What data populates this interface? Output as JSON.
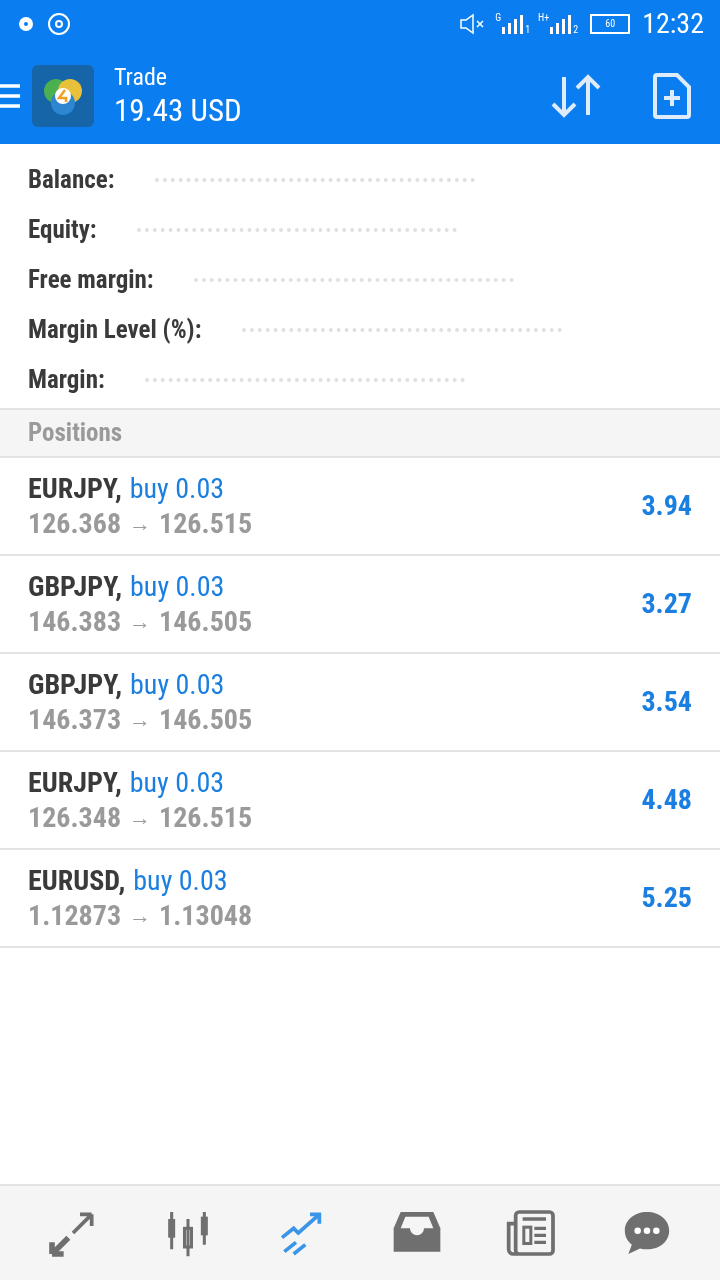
{
  "status_bar": {
    "signals": [
      {
        "network": "G",
        "sim": "1"
      },
      {
        "network": "H+",
        "sim": "2"
      }
    ],
    "battery": "60",
    "time": "12:32"
  },
  "app_bar": {
    "title": "Trade",
    "subtitle": "19.43 USD"
  },
  "account": [
    {
      "label": "Balance:"
    },
    {
      "label": "Equity:"
    },
    {
      "label": "Free margin:"
    },
    {
      "label": "Margin Level (%):"
    },
    {
      "label": "Margin:"
    }
  ],
  "positions": {
    "heading": "Positions",
    "rows": [
      {
        "symbol": "EURJPY,",
        "order": "buy 0.03",
        "open": "126.368",
        "arrow": "→",
        "current": "126.515",
        "profit": "3.94"
      },
      {
        "symbol": "GBPJPY,",
        "order": "buy 0.03",
        "open": "146.383",
        "arrow": "→",
        "current": "146.505",
        "profit": "3.27"
      },
      {
        "symbol": "GBPJPY,",
        "order": "buy 0.03",
        "open": "146.373",
        "arrow": "→",
        "current": "146.505",
        "profit": "3.54"
      },
      {
        "symbol": "EURJPY,",
        "order": "buy 0.03",
        "open": "126.348",
        "arrow": "→",
        "current": "126.515",
        "profit": "4.48"
      },
      {
        "symbol": "EURUSD,",
        "order": "buy 0.03",
        "open": "1.12873",
        "arrow": "→",
        "current": "1.13048",
        "profit": "5.25"
      }
    ]
  },
  "bottom_nav": [
    {
      "kind": "quotes",
      "selected": false
    },
    {
      "kind": "chart",
      "selected": false
    },
    {
      "kind": "trade",
      "selected": true
    },
    {
      "kind": "history",
      "selected": false
    },
    {
      "kind": "news",
      "selected": false
    },
    {
      "kind": "chat",
      "selected": false
    }
  ]
}
